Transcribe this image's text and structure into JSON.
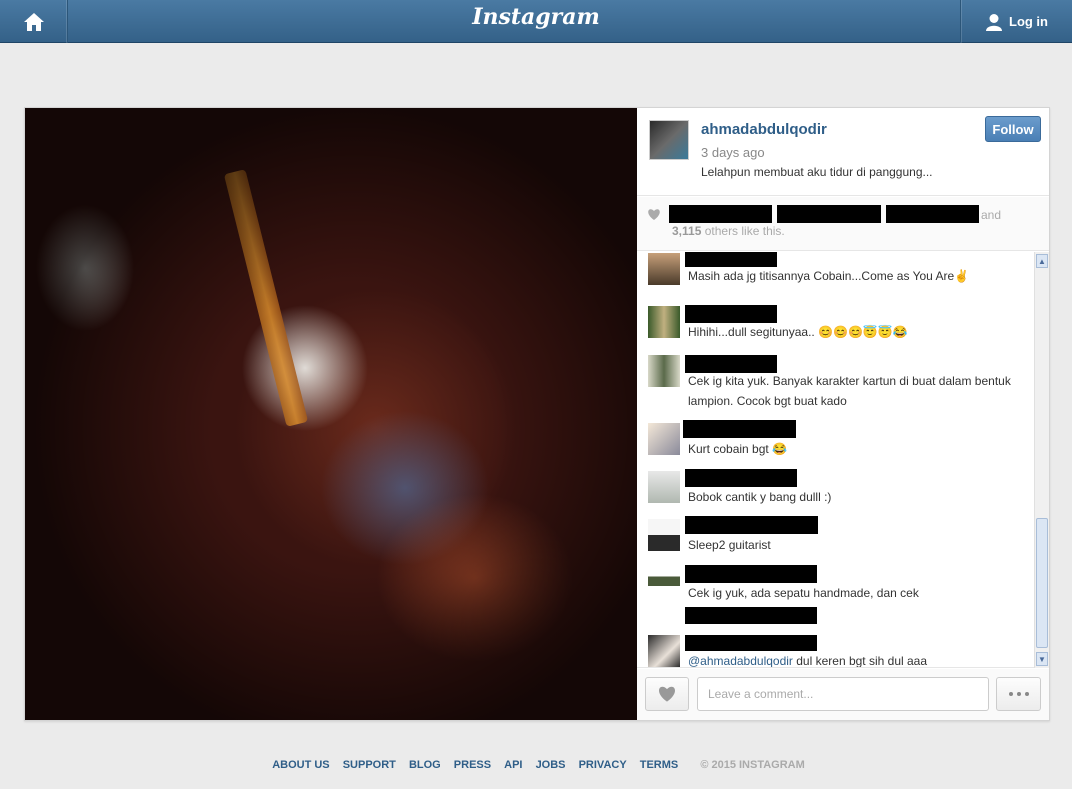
{
  "topbar": {
    "logo": "Instagram",
    "login_label": "Log in",
    "home_icon": "home-icon",
    "user_icon": "user-icon"
  },
  "post": {
    "username": "ahmadabdulqodir",
    "time_ago": "3 days ago",
    "caption": "Lelahpun membuat aku tidur di panggung...",
    "follow_label": "Follow",
    "likes_and": "and",
    "likes_count": "3,115",
    "likes_suffix": " others like this."
  },
  "comments": [
    {
      "text": "Masih ada jg titisannya Cobain...Come as You Are✌"
    },
    {
      "text": "Hihihi...dull segitunyaa.. 😊😊😊😇😇😂"
    },
    {
      "text": "Cek ig kita yuk. Banyak karakter kartun di buat dalam bentuk lampion. Cocok bgt buat kado"
    },
    {
      "text": "Kurt cobain bgt 😂"
    },
    {
      "text": "Bobok cantik y bang dulll :)"
    },
    {
      "text": "Sleep2 guitarist"
    },
    {
      "text": "Cek ig yuk, ada sepatu handmade, dan cek"
    },
    {
      "mention": "@ahmadabdulqodir",
      "text": " dul keren bgt sih dul aaa"
    }
  ],
  "composer": {
    "placeholder": "Leave a comment..."
  },
  "footer": {
    "links": [
      "ABOUT US",
      "SUPPORT",
      "BLOG",
      "PRESS",
      "API",
      "JOBS",
      "PRIVACY",
      "TERMS"
    ],
    "copyright": "© 2015 INSTAGRAM"
  },
  "colors": {
    "topbar": "#3f6e96",
    "link": "#2f5e88",
    "follow": "#5a8cc0"
  }
}
